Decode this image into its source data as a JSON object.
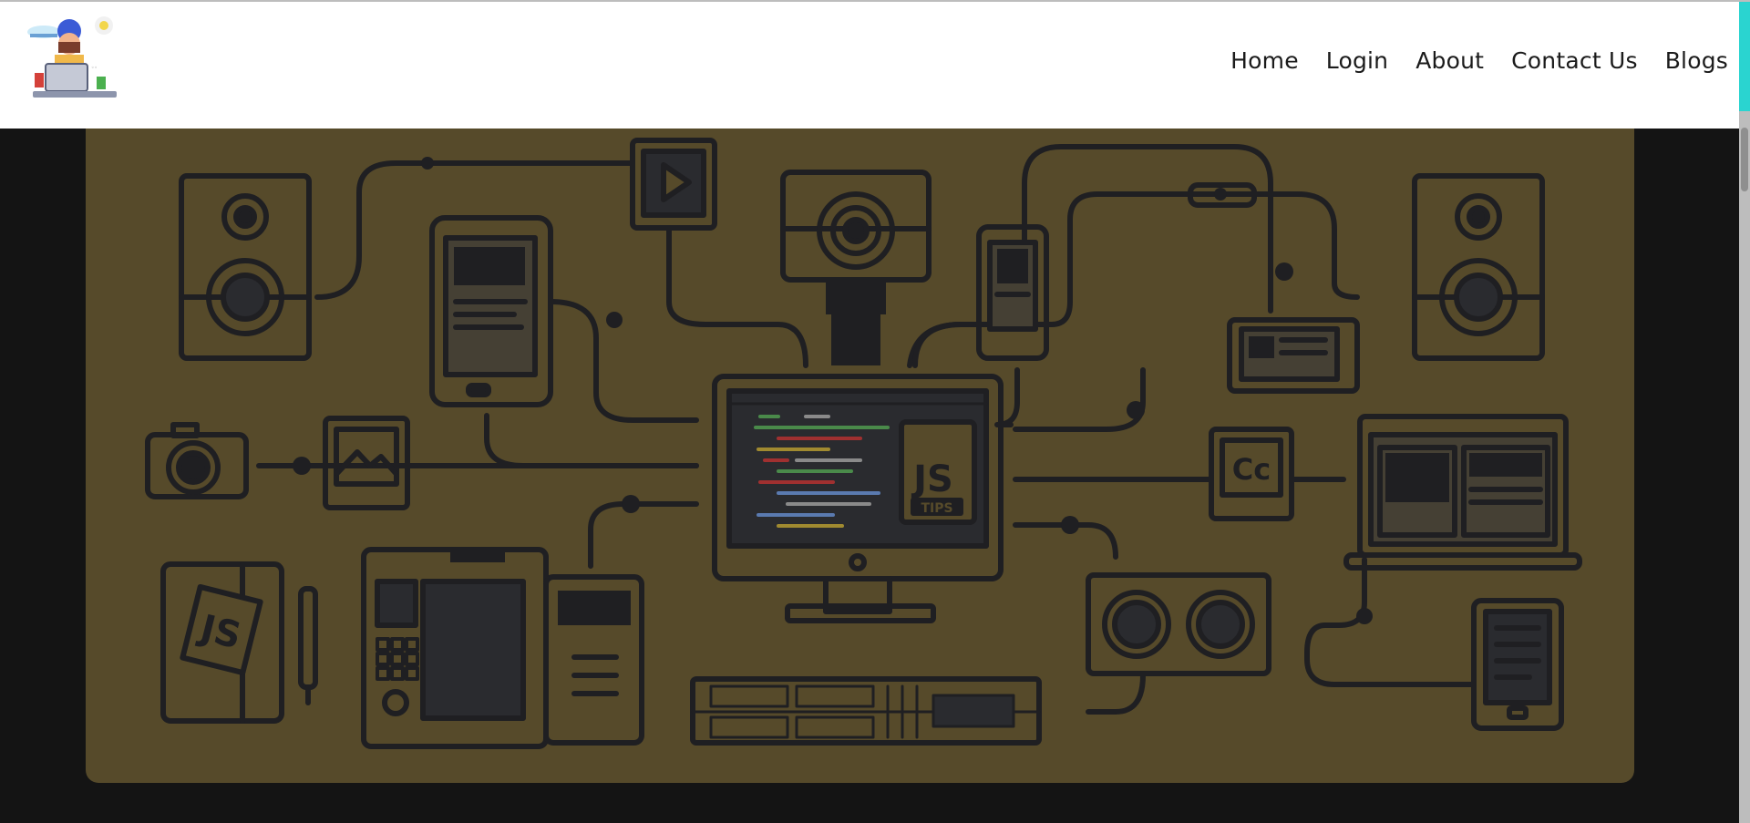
{
  "nav": {
    "items": [
      {
        "label": "Home"
      },
      {
        "label": "Login"
      },
      {
        "label": "About"
      },
      {
        "label": "Contact Us"
      },
      {
        "label": "Blogs"
      }
    ]
  },
  "hero": {
    "js_badge": "JS",
    "tips_badge": "TIPS",
    "cc_badge": "Cc",
    "notebook_badge": "JS"
  },
  "colors": {
    "hero_background": "#564a2a",
    "line_art": "#1f1f22",
    "scroll_accent": "#2ad4d0",
    "page_background": "#141414"
  },
  "icons": [
    "logo-icon",
    "speaker-icon",
    "tablet-icon",
    "play-icon",
    "webcam-icon",
    "phone-icon",
    "projector-icon",
    "monitor-icon",
    "camera-icon",
    "picture-icon",
    "cc-icon",
    "laptop-icon",
    "notebook-icon",
    "pen-icon",
    "coffee-machine-icon",
    "fan-icon",
    "mixer-icon",
    "ereader-icon"
  ]
}
